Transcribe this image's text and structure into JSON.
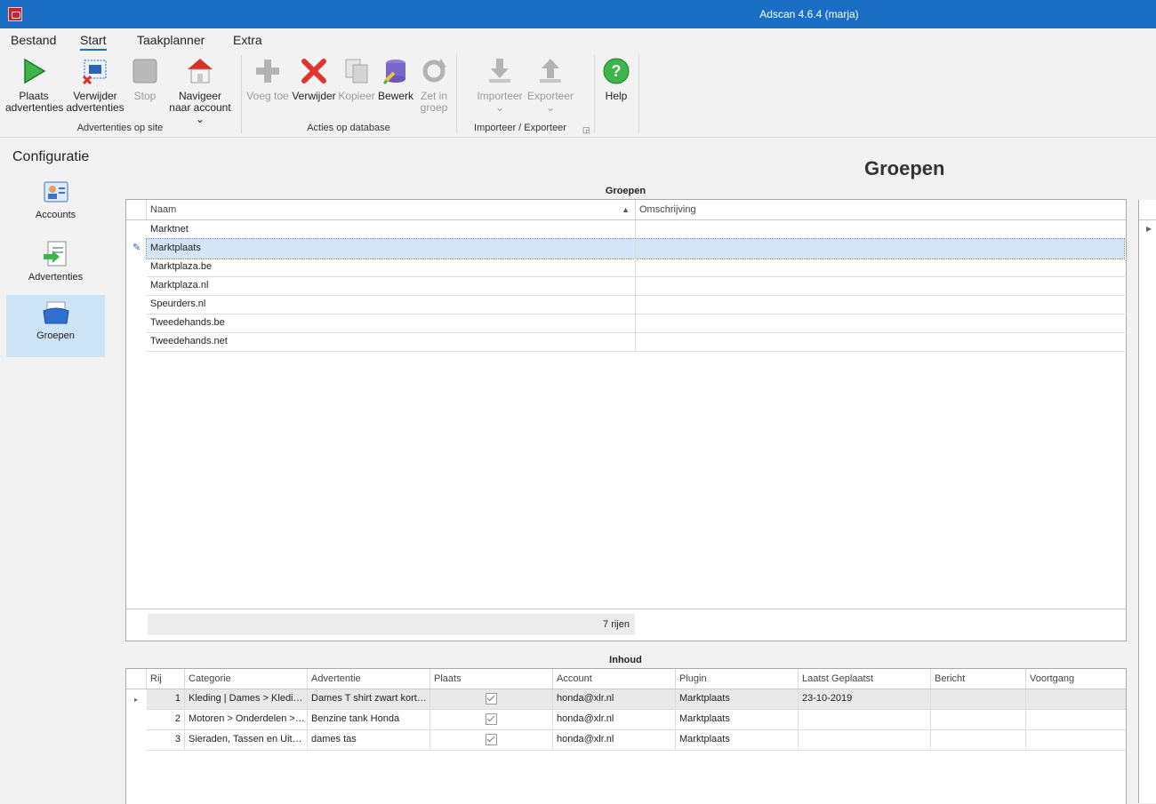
{
  "window": {
    "title": "Adscan 4.6.4 (marja)"
  },
  "menu": {
    "tabs": [
      "Bestand",
      "Start",
      "Taakplanner",
      "Extra"
    ],
    "active": "Start"
  },
  "ribbon": {
    "groups": {
      "site": "Advertenties op site",
      "database": "Acties op database",
      "io": "Importeer / Exporteer"
    },
    "buttons": {
      "plaats": [
        "Plaats",
        "advertenties"
      ],
      "verwijder_adv": [
        "Verwijder",
        "advertenties"
      ],
      "stop": "Stop",
      "navigeer": [
        "Navigeer",
        "naar account"
      ],
      "voeg_toe": "Voeg toe",
      "verwijder": "Verwijder",
      "kopieer": "Kopieer",
      "bewerk": "Bewerk",
      "zet_in_groep": [
        "Zet in",
        "groep"
      ],
      "importeer": "Importeer",
      "exporteer": "Exporteer",
      "help": "Help"
    }
  },
  "sidebar": {
    "title": "Configuratie",
    "items": [
      {
        "label": "Accounts",
        "icon": "accounts-icon"
      },
      {
        "label": "Advertenties",
        "icon": "advertenties-icon"
      },
      {
        "label": "Groepen",
        "icon": "groepen-icon"
      }
    ],
    "selected": "Groepen"
  },
  "page": {
    "title": "Groepen"
  },
  "groepen_grid": {
    "caption": "Groepen",
    "columns": [
      "Naam",
      "Omschrijving"
    ],
    "rows": [
      {
        "naam": "Marktnet",
        "omschrijving": ""
      },
      {
        "naam": "Marktplaats",
        "omschrijving": ""
      },
      {
        "naam": "Marktplaza.be",
        "omschrijving": ""
      },
      {
        "naam": "Marktplaza.nl",
        "omschrijving": ""
      },
      {
        "naam": "Speurders.nl",
        "omschrijving": ""
      },
      {
        "naam": "Tweedehands.be",
        "omschrijving": ""
      },
      {
        "naam": "Tweedehands.net",
        "omschrijving": ""
      }
    ],
    "selected_row": "Marktplaats",
    "footer": "7 rijen"
  },
  "inhoud_grid": {
    "caption": "Inhoud",
    "columns": [
      "Rij",
      "Categorie",
      "Advertentie",
      "Plaats",
      "Account",
      "Plugin",
      "Laatst Geplaatst",
      "Bericht",
      "Voortgang"
    ],
    "rows": [
      {
        "rij": "1",
        "categorie": "Kleding | Dames > Kledin…",
        "advertentie": "Dames T shirt zwart kort…",
        "plaats": true,
        "account": "honda@xlr.nl",
        "plugin": "Marktplaats",
        "laatst": "23-10-2019",
        "bericht": "",
        "voortgang": ""
      },
      {
        "rij": "2",
        "categorie": "Motoren > Onderdelen >…",
        "advertentie": "Benzine tank Honda",
        "plaats": true,
        "account": "honda@xlr.nl",
        "plugin": "Marktplaats",
        "laatst": "",
        "bericht": "",
        "voortgang": ""
      },
      {
        "rij": "3",
        "categorie": "Sieraden, Tassen en Uite…",
        "advertentie": "dames tas",
        "plaats": true,
        "account": "honda@xlr.nl",
        "plugin": "Marktplaats",
        "laatst": "",
        "bericht": "",
        "voortgang": ""
      }
    ]
  },
  "colors": {
    "titlebar": "#1a6fc4",
    "selection": "#d3e5f7",
    "nav_selected": "#cde3f6"
  }
}
